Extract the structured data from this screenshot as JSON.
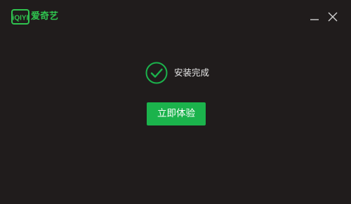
{
  "app": {
    "brand_logo_text": "iQIYI",
    "brand_name": "爱奇艺",
    "brand_color": "#2fc44f"
  },
  "window_controls": {
    "minimize_icon": "minimize-icon",
    "close_icon": "close-icon"
  },
  "status": {
    "icon": "check-circle-icon",
    "text": "安装完成"
  },
  "actions": {
    "primary_label": "立即体验",
    "primary_color": "#1bb34c"
  },
  "theme": {
    "background": "#201c1c"
  }
}
